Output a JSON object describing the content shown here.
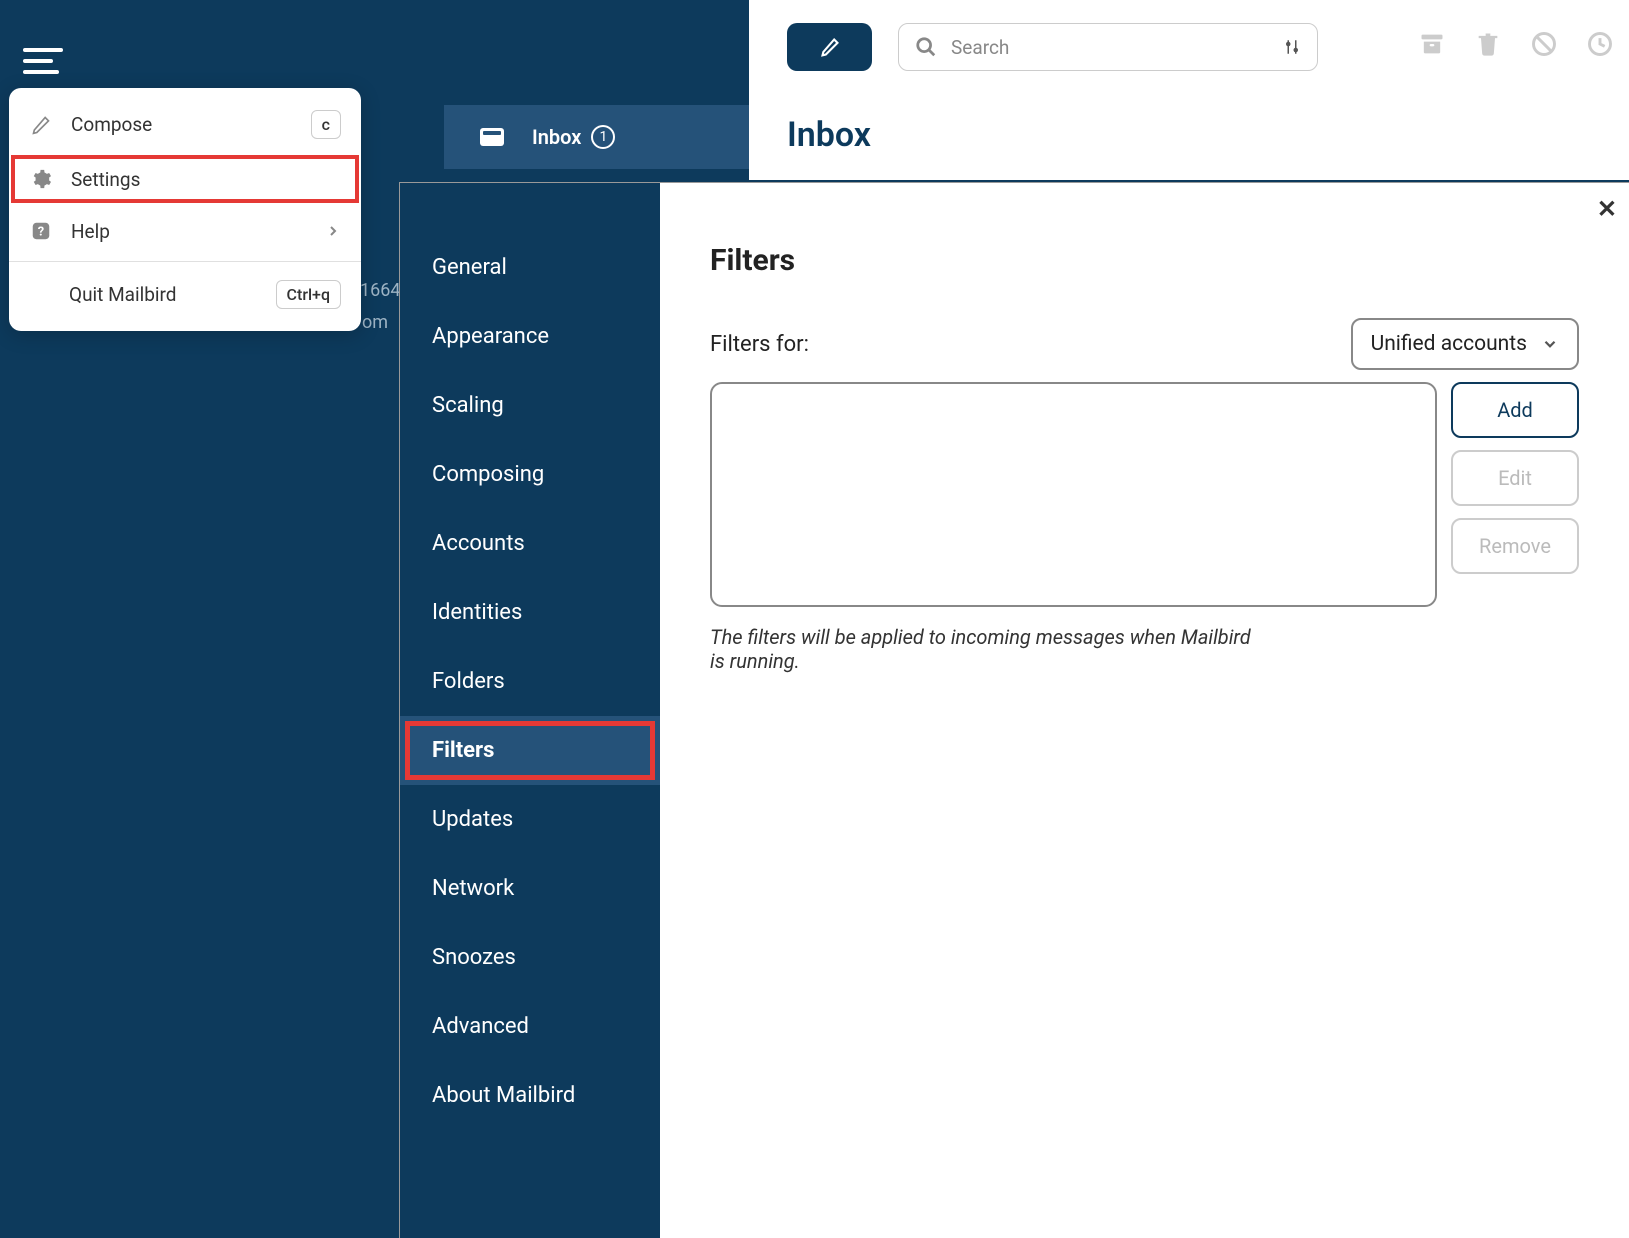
{
  "hamburger_menu": {
    "items": [
      {
        "icon": "pencil-icon",
        "label": "Compose",
        "shortcut": "c",
        "highlighted": false,
        "has_chevron": false
      },
      {
        "icon": "gear-icon",
        "label": "Settings",
        "shortcut": null,
        "highlighted": true,
        "has_chevron": false
      },
      {
        "icon": "help-icon",
        "label": "Help",
        "shortcut": null,
        "highlighted": false,
        "has_chevron": true
      }
    ],
    "quit": {
      "label": "Quit Mailbird",
      "shortcut": "Ctrl+q"
    }
  },
  "background_text": {
    "partial1": "1664",
    "partial2": "om"
  },
  "inbox_bar": {
    "label": "Inbox",
    "count": "1"
  },
  "toolbar": {
    "search_placeholder": "Search"
  },
  "page_title": "Inbox",
  "settings": {
    "nav_items": [
      {
        "label": "General",
        "active": false,
        "highlighted": false
      },
      {
        "label": "Appearance",
        "active": false,
        "highlighted": false
      },
      {
        "label": "Scaling",
        "active": false,
        "highlighted": false
      },
      {
        "label": "Composing",
        "active": false,
        "highlighted": false
      },
      {
        "label": "Accounts",
        "active": false,
        "highlighted": false
      },
      {
        "label": "Identities",
        "active": false,
        "highlighted": false
      },
      {
        "label": "Folders",
        "active": false,
        "highlighted": false
      },
      {
        "label": "Filters",
        "active": true,
        "highlighted": true
      },
      {
        "label": "Updates",
        "active": false,
        "highlighted": false
      },
      {
        "label": "Network",
        "active": false,
        "highlighted": false
      },
      {
        "label": "Snoozes",
        "active": false,
        "highlighted": false
      },
      {
        "label": "Advanced",
        "active": false,
        "highlighted": false
      },
      {
        "label": "About Mailbird",
        "active": false,
        "highlighted": false
      }
    ],
    "filters": {
      "title": "Filters",
      "for_label": "Filters for:",
      "dropdown_selected": "Unified accounts",
      "add_button": "Add",
      "edit_button": "Edit",
      "remove_button": "Remove",
      "help_text": "The filters will be applied to incoming messages when Mailbird is running."
    }
  }
}
